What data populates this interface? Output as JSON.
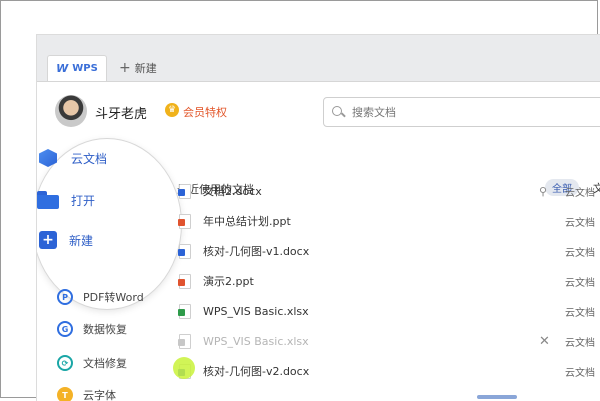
{
  "tabs": {
    "app_tab": "WPS",
    "new_tab": "新建"
  },
  "user": {
    "name": "斗牙老虎",
    "badge": "会员特权"
  },
  "search": {
    "placeholder": "搜索文档"
  },
  "nav": [
    {
      "label": "云文档",
      "icon": "cloud-cube-icon"
    },
    {
      "label": "打开",
      "icon": "folder-icon"
    },
    {
      "label": "新建",
      "icon": "plus-square-icon"
    }
  ],
  "tools": [
    {
      "label": "PDF转Word",
      "icon": "pdf-convert-icon",
      "glyph": "P"
    },
    {
      "label": "数据恢复",
      "icon": "data-recovery-icon",
      "glyph": "G"
    },
    {
      "label": "文档修复",
      "icon": "doc-repair-icon",
      "glyph": "⟳"
    },
    {
      "label": "云字体",
      "icon": "cloud-font-icon",
      "glyph": "T"
    }
  ],
  "recent": {
    "title": "最近使用的文档",
    "filter": "全部",
    "col": "文",
    "docs": [
      {
        "name": "文档2.docx",
        "type": "word",
        "location": "云文档"
      },
      {
        "name": "年中总结计划.ppt",
        "type": "ppt",
        "location": "云文档"
      },
      {
        "name": "核对-几何图-v1.docx",
        "type": "word",
        "location": "云文档"
      },
      {
        "name": "演示2.ppt",
        "type": "ppt",
        "location": "云文档"
      },
      {
        "name": "WPS_VIS Basic.xlsx",
        "type": "xls",
        "location": "云文档"
      },
      {
        "name": "WPS_VIS Basic.xlsx",
        "type": "xls-faded",
        "location": "云文档"
      },
      {
        "name": "核对-几何图-v2.docx",
        "type": "word",
        "location": "云文档"
      }
    ]
  },
  "colors": {
    "accent": "#2f6ee0",
    "badge_text": "#e2562a",
    "faded_text": "#b5b5b5"
  }
}
